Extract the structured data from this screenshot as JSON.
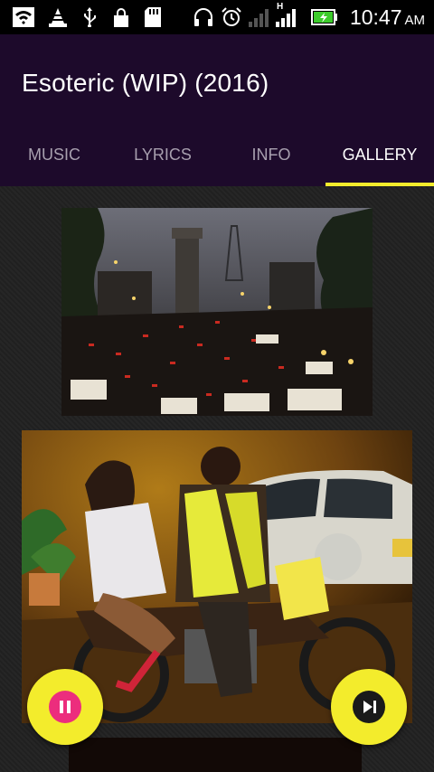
{
  "status_bar": {
    "time": "10:47",
    "ampm": "AM",
    "network_type": "H",
    "icons": [
      "wifi-icon",
      "vlc-cone-icon",
      "usb-icon",
      "lock-icon",
      "sd-card-icon",
      "headphones-icon",
      "alarm-icon",
      "signal-icon",
      "signal-icon",
      "battery-charging-icon"
    ]
  },
  "app": {
    "title": "Esoteric (WIP) (2016)"
  },
  "tabs": [
    {
      "label": "MUSIC",
      "active": false
    },
    {
      "label": "LYRICS",
      "active": false
    },
    {
      "label": "INFO",
      "active": false
    },
    {
      "label": "GALLERY",
      "active": true
    }
  ],
  "gallery": {
    "images": [
      "traffic-jam-photo",
      "motorcycle-taxi-photo",
      "dark-photo"
    ]
  },
  "controls": {
    "pause_icon": "pause-icon",
    "next_icon": "skip-next-icon"
  },
  "colors": {
    "appbar": "#1d0a2b",
    "accent_yellow": "#f3ec2c",
    "pause_pink": "#ec2d7d"
  }
}
